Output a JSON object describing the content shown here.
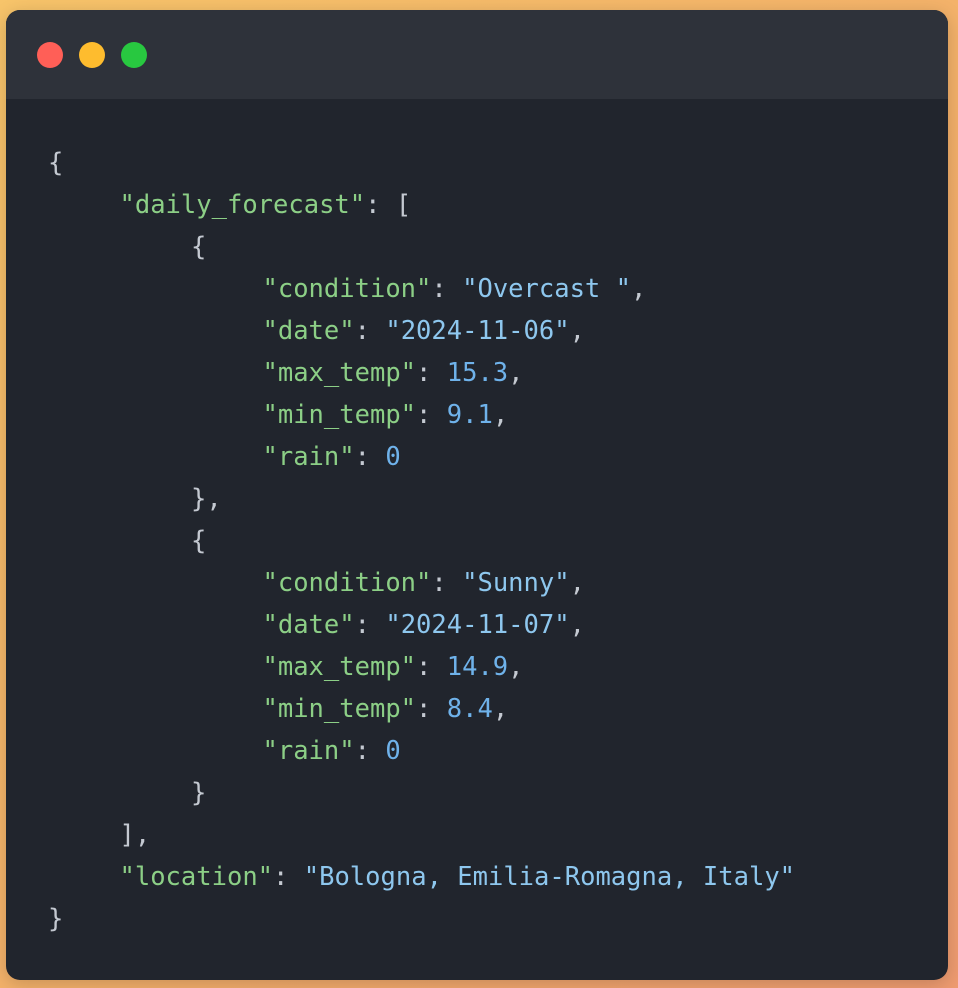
{
  "window": {
    "buttons": [
      "close",
      "minimize",
      "maximize"
    ],
    "colors": {
      "background": "#21252d",
      "titlebar": "#2e323a",
      "key": "#8ccf86",
      "string": "#8ec7ee",
      "number": "#6fb2ea",
      "punctuation": "#c4c9d1"
    }
  },
  "json": {
    "daily_forecast_key": "\"daily_forecast\"",
    "location_key": "\"location\"",
    "location_value": "\"Bologna, Emilia-Romagna, Italy\"",
    "days": [
      {
        "condition_key": "\"condition\"",
        "condition_value": "\"Overcast \"",
        "date_key": "\"date\"",
        "date_value": "\"2024-11-06\"",
        "max_temp_key": "\"max_temp\"",
        "max_temp_value": "15.3",
        "min_temp_key": "\"min_temp\"",
        "min_temp_value": "9.1",
        "rain_key": "\"rain\"",
        "rain_value": "0"
      },
      {
        "condition_key": "\"condition\"",
        "condition_value": "\"Sunny\"",
        "date_key": "\"date\"",
        "date_value": "\"2024-11-07\"",
        "max_temp_key": "\"max_temp\"",
        "max_temp_value": "14.9",
        "min_temp_key": "\"min_temp\"",
        "min_temp_value": "8.4",
        "rain_key": "\"rain\"",
        "rain_value": "0"
      }
    ]
  }
}
